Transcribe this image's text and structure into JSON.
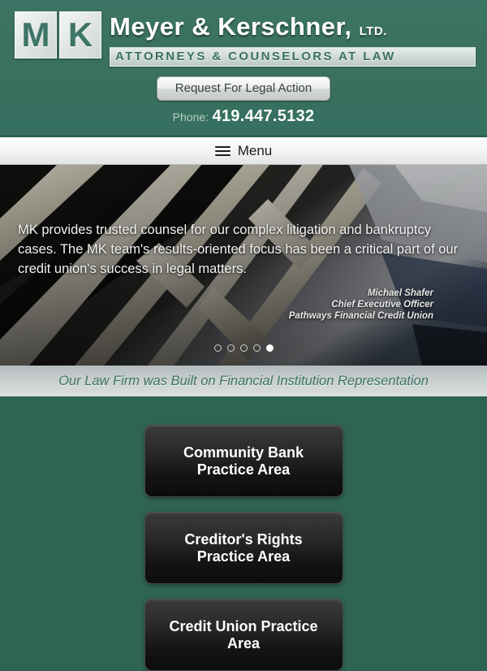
{
  "header": {
    "logo": {
      "box1": "M",
      "box2": "K",
      "firm_name": "Meyer & Kerschner,",
      "firm_suffix": "LTD.",
      "firm_tagline": "ATTORNEYS & COUNSELORS AT LAW"
    },
    "cta_label": "Request For Legal Action",
    "phone_label": "Phone:",
    "phone_number": "419.447.5132",
    "brand_green": "#3a7060"
  },
  "menubar": {
    "label": "Menu",
    "icon": "hamburger-icon"
  },
  "hero": {
    "quote": "MK provides trusted counsel for our complex litigation and bankruptcy cases. The MK team's results-oriented focus has been a critical part of our credit union's success in legal matters.",
    "attribution": {
      "name": "Michael Shafer",
      "title": "Chief Executive Officer",
      "organization": "Pathways Financial Credit Union"
    },
    "slides_total": 5,
    "active_slide": 5
  },
  "tagline_bar": {
    "text": "Our Law Firm was Built on Financial Institution Representation",
    "text_color": "#3b7263"
  },
  "practice_areas": {
    "items": [
      {
        "label": "Community Bank Practice Area"
      },
      {
        "label": "Creditor's Rights Practice Area"
      },
      {
        "label": "Credit Union Practice Area"
      }
    ],
    "background_color": "#2f6354"
  }
}
